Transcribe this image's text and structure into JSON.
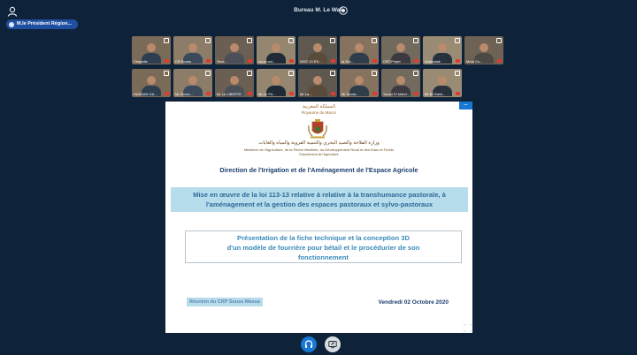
{
  "header": {
    "title": "Bureau M. Le Wali"
  },
  "presenter": {
    "label": "M.le Président Région..."
  },
  "participants": [
    {
      "name": "Chapelle"
    },
    {
      "name": "CR Souss"
    },
    {
      "name": "Secr..."
    },
    {
      "name": "sous roxl..."
    },
    {
      "name": "2007-10 ED..."
    },
    {
      "name": "la Gm..."
    },
    {
      "name": "CEF Projet"
    },
    {
      "name": "Ambbalak"
    },
    {
      "name": "Mme Co..."
    },
    {
      "name": "HASSAN GA..."
    },
    {
      "name": "Mr Grosx..."
    },
    {
      "name": "Mr Le LIBERTE"
    },
    {
      "name": "Mr Le Pd..."
    },
    {
      "name": "Mr La..."
    },
    {
      "name": "Mr Soula..."
    },
    {
      "name": "Yousri El Mahd..."
    },
    {
      "name": "Mr El Habb..."
    }
  ],
  "slide": {
    "kingdom_ar": "المملكة المغربية",
    "kingdom_fr": "Royaume du Maroc",
    "ministry_ar": "وزارة الفلاحة والصيد البحري والتنمية القروية والمياه والغابات",
    "ministry_fr": "Ministère de l'Agriculture, de la Pêche Maritime, du Développement Rural et des Eaux et Forêts",
    "department": "Département de l'Agriculture",
    "direction": "Direction de l'Irrigation et de l'Aménagement de l'Espace Agricole",
    "banner_line1": "Mise en œuvre de la loi 113-13 relative à relative à la transhumance pastorale, à",
    "banner_line2": "l'aménagement et la gestion des espaces pastoraux et sylvo-pastoraux",
    "box_line1": "Présentation de la fiche technique et la conception 3D",
    "box_line2": "d'un modèle de fourrière pour bétail et le procédurier de son",
    "box_line3": "fonctionnement",
    "meeting": "Réunion du CRP Souss Massa",
    "date": "Vendredi 02 Octobre 2020",
    "collapse_symbol": "–"
  },
  "colors": {
    "background": "#0e2339",
    "accent": "#1877d3",
    "banner": "#b7dceb",
    "slide_title": "#1b3e6e"
  }
}
